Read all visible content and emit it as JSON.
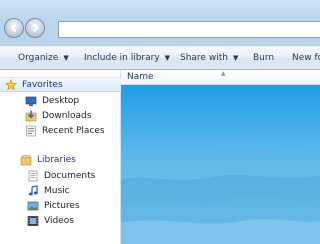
{
  "toolbar": {
    "items": [
      {
        "label": "Organize",
        "has_dropdown": true
      },
      {
        "label": "Include in library",
        "has_dropdown": true
      },
      {
        "label": "Share with",
        "has_dropdown": true
      },
      {
        "label": "Burn",
        "has_dropdown": false
      },
      {
        "label": "New fo",
        "has_dropdown": false
      }
    ]
  },
  "address": {
    "value": ""
  },
  "navpane": {
    "favorites": {
      "label": "Favorites",
      "icon": "star-icon",
      "items": [
        {
          "label": "Desktop",
          "icon": "desktop-icon"
        },
        {
          "label": "Downloads",
          "icon": "downloads-icon"
        },
        {
          "label": "Recent Places",
          "icon": "recent-places-icon"
        }
      ]
    },
    "libraries": {
      "label": "Libraries",
      "icon": "libraries-icon",
      "items": [
        {
          "label": "Documents",
          "icon": "documents-icon"
        },
        {
          "label": "Music",
          "icon": "music-icon"
        },
        {
          "label": "Pictures",
          "icon": "pictures-icon"
        },
        {
          "label": "Videos",
          "icon": "videos-icon"
        }
      ]
    }
  },
  "content": {
    "column_header": "Name"
  },
  "colors": {
    "link_blue": "#1e3287",
    "toolbar_text": "#1e395b",
    "content_blue": "#4db3ea"
  }
}
